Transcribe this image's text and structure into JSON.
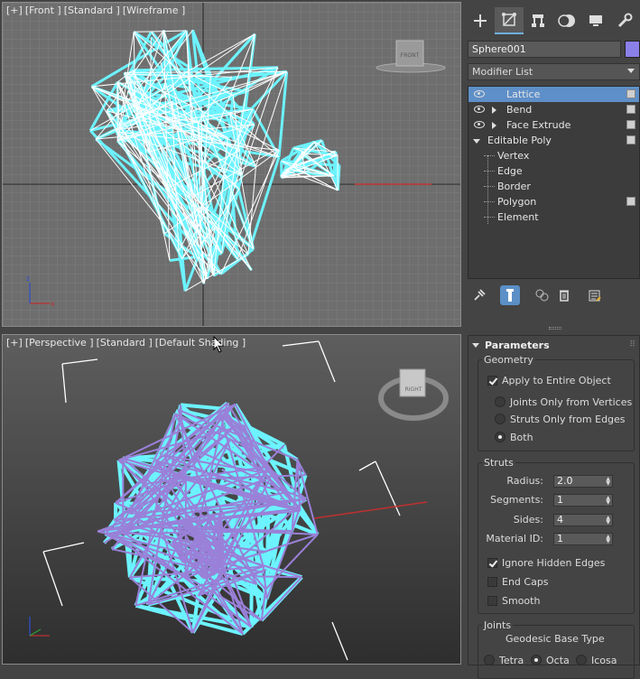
{
  "viewports": {
    "front": {
      "label_parts": [
        "[+]",
        "[Front ]",
        "[Standard ]",
        "[Wireframe ]"
      ],
      "viewcube_label": "FRONT"
    },
    "perspective": {
      "label_parts": [
        "[+]",
        "[Perspective ]",
        "[Standard ]",
        "[Default Shading ]"
      ],
      "viewcube_label": "RIGHT"
    }
  },
  "command_panel": {
    "tabs": [
      "create-icon",
      "modify-icon",
      "hierarchy-icon",
      "motion-icon",
      "display-icon",
      "utilities-icon"
    ],
    "active_tab": 1,
    "object_name": "Sphere001",
    "object_color": "#8b7fe8",
    "modifier_list": "Modifier List",
    "stack": [
      {
        "label": "Lattice",
        "eye": true,
        "expand": false,
        "selected": true
      },
      {
        "label": "Bend",
        "eye": true,
        "expand": true
      },
      {
        "label": "Face Extrude",
        "eye": true,
        "expand": true
      },
      {
        "label": "Editable Poly",
        "eye": false,
        "expand": false
      },
      {
        "label": "Vertex",
        "sub": true
      },
      {
        "label": "Edge",
        "sub": true
      },
      {
        "label": "Border",
        "sub": true
      },
      {
        "label": "Polygon",
        "sub": true
      },
      {
        "label": "Element",
        "sub": true
      }
    ]
  },
  "parameters": {
    "title": "Parameters",
    "geometry": {
      "title": "Geometry",
      "apply_entire": "Apply to Entire Object",
      "apply_entire_checked": true,
      "options": [
        "Joints Only from Vertices",
        "Struts Only from Edges",
        "Both"
      ],
      "selected_option": 2
    },
    "struts": {
      "title": "Struts",
      "radius_label": "Radius:",
      "radius": "2.0",
      "segments_label": "Segments:",
      "segments": "1",
      "sides_label": "Sides:",
      "sides": "4",
      "material_label": "Material ID:",
      "material": "1",
      "ignore_hidden": "Ignore Hidden Edges",
      "ignore_hidden_checked": true,
      "end_caps": "End Caps",
      "end_caps_checked": false,
      "smooth": "Smooth",
      "smooth_checked": false
    },
    "joints": {
      "title": "Joints",
      "geodesic": "Geodesic Base Type",
      "options": [
        "Tetra",
        "Octa",
        "Icosa"
      ],
      "selected_option": 1
    }
  },
  "colors": {
    "wire_cyan": "#6cf3ff",
    "wire_purple": "#9a80d8",
    "selected_blue": "#5f8fc8"
  }
}
